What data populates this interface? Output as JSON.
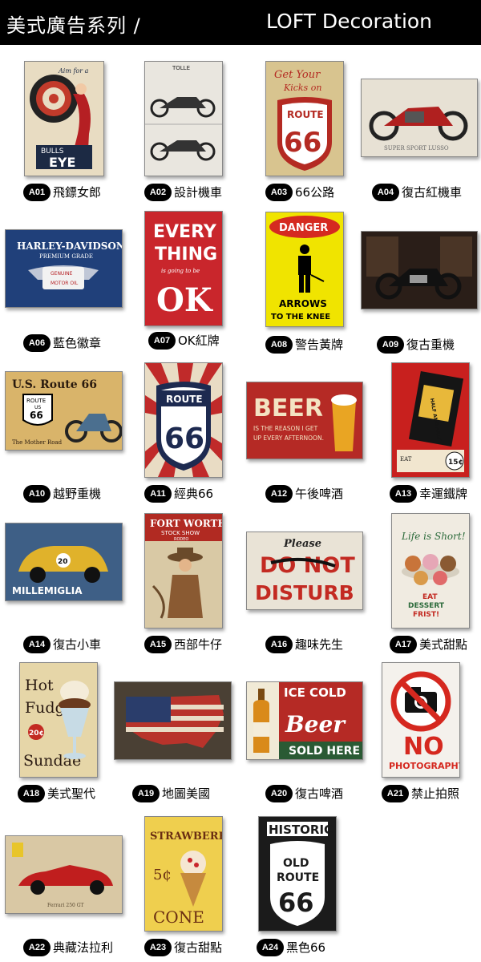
{
  "header": {
    "left_title": "美式廣告系列 /",
    "right_title": "LOFT Decoration",
    "bg_color": "#000000"
  },
  "items": [
    {
      "code": "A01",
      "name": "飛鏢女郎",
      "sign_text": [
        "Aim for a",
        "BULLS",
        "EYE"
      ],
      "icon": "pinup-dartboard-icon"
    },
    {
      "code": "A02",
      "name": "設計機車",
      "sign_text": [
        "TOLLE"
      ],
      "icon": "motorcycle-blueprint-icon"
    },
    {
      "code": "A03",
      "name": "66公路",
      "sign_text": [
        "Get Your",
        "Kicks on",
        "ROUTE",
        "66"
      ],
      "icon": "route66-shield-icon"
    },
    {
      "code": "A04",
      "name": "復古紅機車",
      "sign_text": [
        "SUPER SPORT LUSSO"
      ],
      "icon": "red-motorcycle-icon"
    },
    {
      "code": "A06",
      "name": "藍色徽章",
      "sign_text": [
        "HARLEY-DAVIDSON",
        "PREMIUM GRADE",
        "GENUINE",
        "MOTOR OIL"
      ],
      "icon": "harley-badge-icon"
    },
    {
      "code": "A07",
      "name": "OK紅牌",
      "sign_text": [
        "EVERY",
        "THING",
        "is going to be",
        "OK"
      ],
      "icon": "ok-sign-icon"
    },
    {
      "code": "A08",
      "name": "警告黃牌",
      "sign_text": [
        "DANGER",
        "ARROWS",
        "TO THE KNEE"
      ],
      "icon": "danger-sign-icon"
    },
    {
      "code": "A09",
      "name": "復古重機",
      "sign_text": [],
      "icon": "dark-motorcycle-icon"
    },
    {
      "code": "A10",
      "name": "越野重機",
      "sign_text": [
        "U.S. Route 66",
        "ROUTE",
        "US",
        "66",
        "The Mother Road"
      ],
      "icon": "route66-map-icon"
    },
    {
      "code": "A11",
      "name": "經典66",
      "sign_text": [
        "ROUTE",
        "66"
      ],
      "icon": "route66-sunburst-icon"
    },
    {
      "code": "A12",
      "name": "午後啤酒",
      "sign_text": [
        "BEER",
        "IS THE REASON I GET",
        "UP EVERY AFTERNOON."
      ],
      "icon": "beer-glass-icon"
    },
    {
      "code": "A13",
      "name": "幸運鐵牌",
      "sign_text": [
        "HALF AND HALF",
        "EAT",
        "15¢"
      ],
      "icon": "half-and-half-icon"
    },
    {
      "code": "A14",
      "name": "復古小車",
      "sign_text": [
        "MILLEMIGLIA",
        "20"
      ],
      "icon": "vintage-car-icon"
    },
    {
      "code": "A15",
      "name": "西部牛仔",
      "sign_text": [
        "FORT WORTH",
        "STOCK SHOW",
        "RODEO"
      ],
      "icon": "cowboy-icon"
    },
    {
      "code": "A16",
      "name": "趣味先生",
      "sign_text": [
        "Please",
        "DO NOT",
        "DISTURB"
      ],
      "icon": "do-not-disturb-icon"
    },
    {
      "code": "A17",
      "name": "美式甜點",
      "sign_text": [
        "Life is Short!",
        "EAT",
        "DESSERT",
        "FRIST!"
      ],
      "icon": "donuts-icon"
    },
    {
      "code": "A18",
      "name": "美式聖代",
      "sign_text": [
        "Hot",
        "Fudge",
        "20¢",
        "Sundae"
      ],
      "icon": "sundae-icon"
    },
    {
      "code": "A19",
      "name": "地圖美國",
      "sign_text": [],
      "icon": "usa-flag-map-icon"
    },
    {
      "code": "A20",
      "name": "復古啤酒",
      "sign_text": [
        "ICE COLD",
        "Beer",
        "SOLD HERE"
      ],
      "icon": "beer-bottle-icon"
    },
    {
      "code": "A21",
      "name": "禁止拍照",
      "sign_text": [
        "NO",
        "PHOTOGRAPHY"
      ],
      "icon": "no-camera-icon"
    },
    {
      "code": "A22",
      "name": "典藏法拉利",
      "sign_text": [
        "Ferrari 250 GT"
      ],
      "icon": "ferrari-icon"
    },
    {
      "code": "A23",
      "name": "復古甜點",
      "sign_text": [
        "STRAWBERRY",
        "5¢",
        "CONE"
      ],
      "icon": "ice-cream-cone-icon"
    },
    {
      "code": "A24",
      "name": "黑色66",
      "sign_text": [
        "HISTORIC",
        "OLD",
        "ROUTE",
        "66"
      ],
      "icon": "historic-route66-icon"
    }
  ]
}
